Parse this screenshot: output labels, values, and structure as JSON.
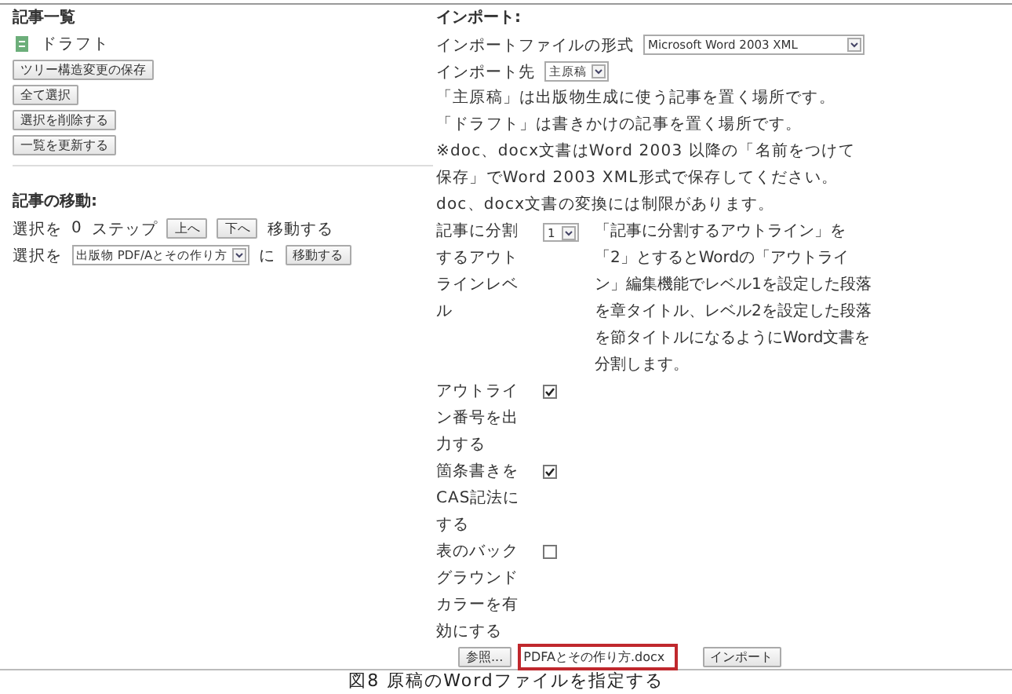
{
  "article_list": {
    "title": "記事一覧",
    "tree": [
      {
        "label": "ドラフト"
      }
    ],
    "buttons": [
      "ツリー構造変更の保存",
      "全て選択",
      "選択を削除する",
      "一覧を更新する"
    ]
  },
  "move": {
    "title": "記事の移動:",
    "step_row": {
      "prefix": "選択を",
      "steps": "0",
      "unit": "ステップ",
      "up": "上へ",
      "down": "下へ",
      "suffix": "移動する"
    },
    "target_row": {
      "prefix": "選択を",
      "target": "出版物 PDF/Aとその作り方",
      "particle": "に",
      "button": "移動する"
    }
  },
  "import": {
    "title": "インポート:",
    "format": {
      "label": "インポートファイルの形式",
      "value": "Microsoft Word 2003 XML"
    },
    "destination": {
      "label": "インポート先",
      "value": "主原稿"
    },
    "notes": [
      "「主原稿」は出版物生成に使う記事を置く場所です。",
      "「ドラフト」は書きかけの記事を置く場所です。",
      "※doc、docx文書はWord 2003 以降の「名前をつけて保存」でWord 2003 XML形式で保存してください。doc、docx文書の変換には制限があります。"
    ],
    "options": [
      {
        "kind": "select",
        "label": "記事に分割するアウトラインレベル",
        "value": "1",
        "description": "「記事に分割するアウトライン」を「2」とするとWordの「アウトライン」編集機能でレベル1を設定した段落を章タイトル、レベル2を設定した段落を節タイトルになるようにWord文書を分割します。"
      },
      {
        "kind": "checkbox",
        "label": "アウトライン番号を出力する",
        "checked": true
      },
      {
        "kind": "checkbox",
        "label": "箇条書きをCAS記法にする",
        "checked": true
      },
      {
        "kind": "checkbox",
        "label": "表のバックグラウンドカラーを有効にする",
        "checked": false
      }
    ],
    "file": {
      "browse": "参照...",
      "value": "PDFAとその作り方.docx",
      "highlighted": true
    },
    "submit": "インポート"
  },
  "caption": "図8 原稿のWordファイルを指定する"
}
